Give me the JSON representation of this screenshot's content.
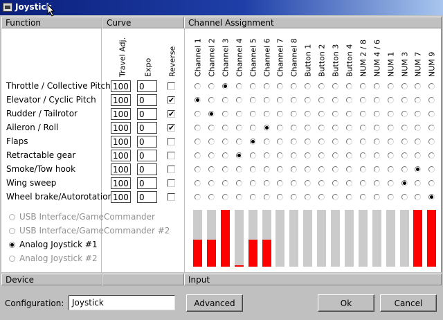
{
  "window": {
    "title": "Joystick"
  },
  "headers": {
    "function": "Function",
    "curve": "Curve",
    "channel_assignment": "Channel Assignment",
    "device": "Device",
    "input": "Input"
  },
  "columns": {
    "travel_adj": "Travel Adj.",
    "expo": "Expo",
    "reverse": "Reverse"
  },
  "channels": [
    "Channel 1",
    "Channel 2",
    "Channel 3",
    "Channel 4",
    "Channel 5",
    "Channel 6",
    "Channel 7",
    "Channel 8",
    "Button 1",
    "Button 2",
    "Button 3",
    "Button 4",
    "NUM 2 / 8",
    "NUM 4 / 6",
    "NUM 1",
    "NUM 3",
    "NUM 7",
    "NUM 9"
  ],
  "functions": [
    {
      "name": "Throttle / Collective Pitch",
      "travel": "100",
      "expo": "0",
      "reverse": false,
      "channel_index": 2
    },
    {
      "name": "Elevator / Cyclic Pitch",
      "travel": "100",
      "expo": "0",
      "reverse": true,
      "channel_index": 0
    },
    {
      "name": "Rudder / Tailrotor",
      "travel": "100",
      "expo": "0",
      "reverse": true,
      "channel_index": 1
    },
    {
      "name": "Aileron / Roll",
      "travel": "100",
      "expo": "0",
      "reverse": true,
      "channel_index": 5
    },
    {
      "name": "Flaps",
      "travel": "100",
      "expo": "0",
      "reverse": false,
      "channel_index": 4
    },
    {
      "name": "Retractable gear",
      "travel": "100",
      "expo": "0",
      "reverse": false,
      "channel_index": 3
    },
    {
      "name": "Smoke/Tow hook",
      "travel": "100",
      "expo": "0",
      "reverse": false,
      "channel_index": 16
    },
    {
      "name": "Wing sweep",
      "travel": "100",
      "expo": "0",
      "reverse": false,
      "channel_index": 15
    },
    {
      "name": "Wheel brake/Autorotation",
      "travel": "100",
      "expo": "0",
      "reverse": false,
      "channel_index": 17
    }
  ],
  "devices": [
    {
      "label": "USB Interface/GameCommander",
      "selected": false,
      "enabled": false
    },
    {
      "label": "USB Interface/GameCommander #2",
      "selected": false,
      "enabled": false
    },
    {
      "label": "Analog Joystick #1",
      "selected": true,
      "enabled": true
    },
    {
      "label": "Analog Joystick #2",
      "selected": false,
      "enabled": false
    }
  ],
  "input_levels": [
    0.48,
    0.48,
    1.0,
    0.02,
    0.48,
    0.48,
    0,
    0,
    0,
    0,
    0,
    0,
    0,
    0,
    0,
    0,
    1.0,
    1.0
  ],
  "colors": {
    "input_fill": "#ff0000",
    "input_track": "#cbcbcb",
    "title_bar": "#0a1f7a"
  },
  "footer": {
    "config_label": "Configuration:",
    "config_value": "Joystick",
    "advanced": "Advanced",
    "ok": "Ok",
    "cancel": "Cancel"
  }
}
